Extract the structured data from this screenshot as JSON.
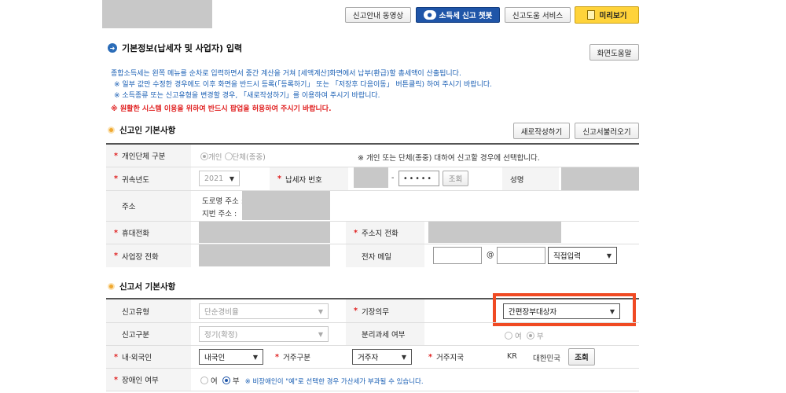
{
  "toolbar": {
    "video_guide": "신고안내 동영상",
    "chatbot": "소득세 신고 챗봇",
    "help_service": "신고도움 서비스",
    "preview": "미리보기"
  },
  "header": {
    "title": "기본정보(납세자 및 사업자) 입력",
    "screen_help": "화면도움말"
  },
  "notice": {
    "line1": "종합소득세는 왼쪽 메뉴를 순차로 입력하면서 중간 계산을 거쳐 [세액계산]화면에서 납부(환급)할 총세액이 산출됩니다.",
    "line2": "※ 일부 값만 수정한 경우에도 이후 화면을 반드시 등록(「등록하기」 또는 「저장후 다음이동」 버튼클릭) 하여 주시기 바랍니다.",
    "line3": "※ 소득종류 또는 신고유형을 변경할 경우, 「새로작성하기」를 이용하여 주시기 바랍니다.",
    "line4": "※ 원활한 시스템 이용을 위하여 반드시 팝업을 허용하여 주시기 바랍니다."
  },
  "reporter": {
    "title": "신고인 기본사항",
    "new_write": "새로작성하기",
    "load": "신고서불러오기",
    "type_label": "개인단체 구분",
    "type_opt_individual": "개인",
    "type_opt_group": "단체(종중)",
    "type_note": "※ 개인 또는 단체(종중) 대하여 신고할 경우에 선택합니다.",
    "year_label": "귀속년도",
    "year_value": "2021",
    "tin_label": "납세자 번호",
    "tin_dash": "-",
    "tin_masked": "•••••",
    "lookup": "조회",
    "name_label": "성명",
    "address_label": "주소",
    "road_address": "도로명 주소 :",
    "lot_address": "지번 주소 :",
    "mobile_label": "휴대전화",
    "home_phone_label": "주소지 전화",
    "biz_phone_label": "사업장 전화",
    "email_label": "전자 메일",
    "email_at": "@",
    "email_domain": "직접입력"
  },
  "filing": {
    "title": "신고서 기본사항",
    "report_type_label": "신고유형",
    "report_type_value": "단순경비율",
    "bookkeeping_label": "기장의무",
    "bookkeeping_value": "간편장부대상자",
    "report_class_label": "신고구분",
    "report_class_value": "정기(확정)",
    "separate_tax_label": "분리과세 여부",
    "yes": "여",
    "no": "부",
    "nationality_label": "내·외국인",
    "nationality_value": "내국인",
    "residence_label": "거주구분",
    "residence_value": "거주자",
    "region_label": "거주지국",
    "region_code": "KR",
    "region_name": "대한민국",
    "disabled_label": "장애인 여부",
    "disabled_note": "※ 비장애인이 \"예\"로 선택한 경우 가산세가 부과될 수 있습니다."
  },
  "colors": {
    "highlight": "#f04a23",
    "primary_blue": "#1f55a8",
    "notice_blue": "#1a5fb4",
    "warn_red": "#e02020"
  }
}
